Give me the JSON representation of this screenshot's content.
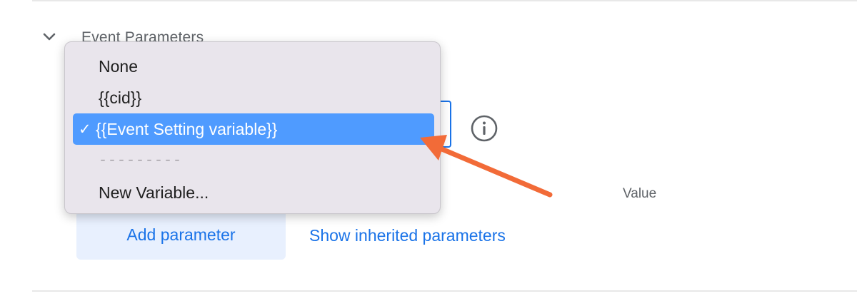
{
  "section": {
    "title": "Event Parameters",
    "collapse_icon": "chevron-down-icon"
  },
  "dropdown": {
    "options": [
      {
        "label": "None",
        "selected": false
      },
      {
        "label": "{{cid}}",
        "selected": false
      },
      {
        "label": "{{Event Setting variable}}",
        "selected": true
      },
      {
        "label": "---------",
        "separator": true
      },
      {
        "label": "New Variable...",
        "selected": false
      }
    ],
    "checkmark": "✓"
  },
  "table": {
    "value_header": "Value"
  },
  "actions": {
    "add_parameter": "Add parameter",
    "show_inherited": "Show inherited parameters"
  },
  "icons": {
    "info": "info-icon",
    "annotation": "orange-arrow-annotation"
  },
  "colors": {
    "accent": "#1a73e8",
    "selected_bg": "#4f9bff",
    "menu_bg": "#e9e5ec",
    "annotation": "#f26b38",
    "button_bg": "#e8f0fe"
  }
}
